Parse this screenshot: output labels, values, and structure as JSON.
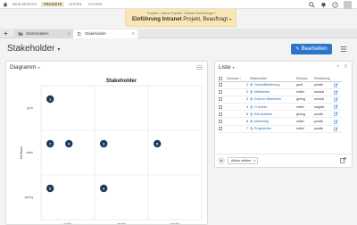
{
  "topbar": {
    "nav": [
      {
        "label": "MEIN BEREICH",
        "active": false
      },
      {
        "label": "PROJEKTE",
        "active": true
      },
      {
        "label": "INTERN",
        "active": false
      },
      {
        "label": "EXTERN",
        "active": false
      }
    ]
  },
  "project": {
    "breadcrumb": "Projekte › Interne Projekte › Software-Einführungen ›",
    "title_bold": "Einführung Intranet",
    "title_rest": " Projekt, Beauftragt"
  },
  "tabs": [
    {
      "label": "Stammdaten"
    },
    {
      "label": "Stakeholder"
    }
  ],
  "page": {
    "title": "Stakeholder",
    "edit_label": "Bearbeiten"
  },
  "diagram": {
    "panel_title": "Diagramm"
  },
  "chart_data": {
    "type": "scatter",
    "title": "Stakeholder",
    "xlabel": "Einstellung",
    "ylabel": "Einfluss",
    "x_categories": [
      "positiv",
      "neutral",
      "negativ"
    ],
    "y_categories": [
      "groß",
      "mittel",
      "gering"
    ],
    "points": [
      {
        "label": "1",
        "x": "positiv",
        "y": "groß"
      },
      {
        "label": "7",
        "x": "positiv",
        "y": "mittel"
      },
      {
        "label": "9",
        "x": "positiv",
        "y": "mittel"
      },
      {
        "label": "3",
        "x": "neutral",
        "y": "mittel"
      },
      {
        "label": "5",
        "x": "negativ",
        "y": "mittel"
      },
      {
        "label": "6",
        "x": "positiv",
        "y": "gering"
      },
      {
        "label": "4",
        "x": "neutral",
        "y": "gering"
      }
    ],
    "point_color": "#1f3b5c"
  },
  "list": {
    "panel_title": "Liste",
    "columns": [
      "Nummer",
      "Stakeholder",
      "Einfluss",
      "Einstellung"
    ],
    "rows": [
      {
        "num": "1",
        "name": "Geschäftsführung",
        "einfluss": "groß",
        "einstellung": "positiv"
      },
      {
        "num": "2",
        "name": "Mitarbeiter",
        "einfluss": "mittel",
        "einstellung": "neutral"
      },
      {
        "num": "3",
        "name": "Externe Mitarbeiter",
        "einfluss": "gering",
        "einstellung": "neutral"
      },
      {
        "num": "4",
        "name": "IT-Admin",
        "einfluss": "mittel",
        "einstellung": "negativ"
      },
      {
        "num": "5",
        "name": "SW-Anbieter",
        "einfluss": "gering",
        "einstellung": "positiv"
      },
      {
        "num": "6",
        "name": "Marketing",
        "einfluss": "mittel",
        "einstellung": "positiv"
      },
      {
        "num": "7",
        "name": "Projektleiter",
        "einfluss": "mittel",
        "einstellung": "positiv"
      }
    ],
    "action_label": "Aktion wählen"
  },
  "colors": {
    "accent": "#2b76c9",
    "project_header": "#f8e7b5",
    "link": "#2b6cb0"
  }
}
